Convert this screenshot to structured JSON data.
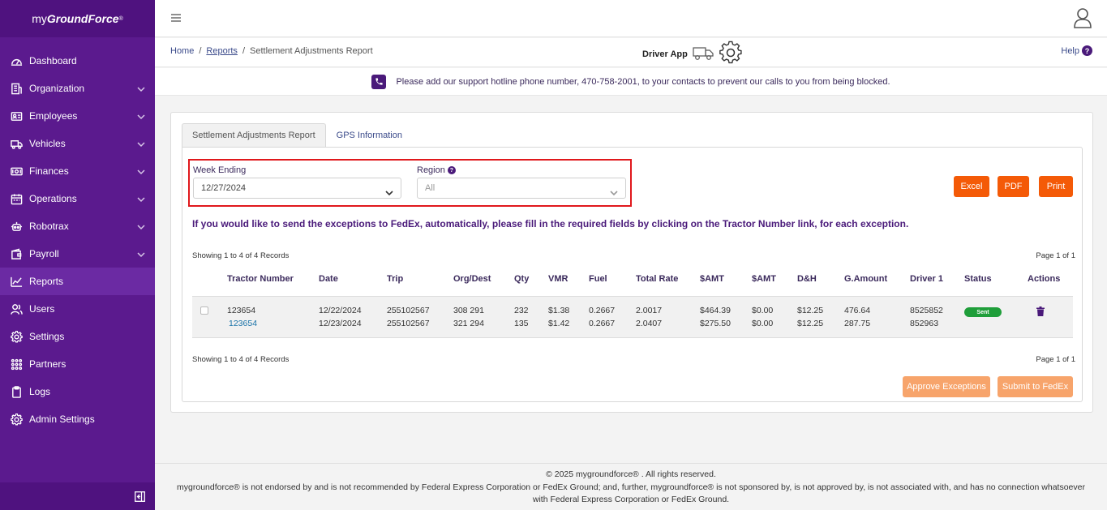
{
  "brand": {
    "prefix": "my",
    "name": "GroundForce",
    "mark": "®"
  },
  "sidebar": {
    "items": [
      {
        "label": "Dashboard",
        "icon": "dashboard-icon",
        "has_chevron": false
      },
      {
        "label": "Organization",
        "icon": "building-icon",
        "has_chevron": true
      },
      {
        "label": "Employees",
        "icon": "id-card-icon",
        "has_chevron": true
      },
      {
        "label": "Vehicles",
        "icon": "truck-icon",
        "has_chevron": true
      },
      {
        "label": "Finances",
        "icon": "money-icon",
        "has_chevron": true
      },
      {
        "label": "Operations",
        "icon": "calendar-icon",
        "has_chevron": true
      },
      {
        "label": "Robotrax",
        "icon": "robot-icon",
        "has_chevron": true
      },
      {
        "label": "Payroll",
        "icon": "wallet-icon",
        "has_chevron": true
      },
      {
        "label": "Reports",
        "icon": "chart-line-icon",
        "has_chevron": false,
        "active": true
      },
      {
        "label": "Users",
        "icon": "users-icon",
        "has_chevron": false
      },
      {
        "label": "Settings",
        "icon": "gear-icon",
        "has_chevron": false
      },
      {
        "label": "Partners",
        "icon": "grid-dots-icon",
        "has_chevron": false
      },
      {
        "label": "Logs",
        "icon": "clipboard-icon",
        "has_chevron": false
      },
      {
        "label": "Admin Settings",
        "icon": "admin-gear-icon",
        "has_chevron": false
      }
    ]
  },
  "breadcrumb": {
    "home": "Home",
    "sep": "/",
    "reports": "Reports",
    "current": "Settlement Adjustments Report"
  },
  "driver_app": {
    "label": "Driver App"
  },
  "help": {
    "label": "Help",
    "icon_text": "?"
  },
  "notice": {
    "text": "Please add our support hotline phone number, 470-758-2001, to your contacts to prevent our calls to you from being blocked."
  },
  "tabs": [
    {
      "label": "Settlement Adjustments Report",
      "active": true
    },
    {
      "label": "GPS Information",
      "active": false
    }
  ],
  "filters": {
    "week_ending": {
      "label": "Week Ending",
      "value": "12/27/2024"
    },
    "region": {
      "label": "Region",
      "value": "All",
      "help": "?"
    }
  },
  "buttons": {
    "excel": "Excel",
    "pdf": "PDF",
    "print": "Print",
    "approve": "Approve Exceptions",
    "submit": "Submit to FedEx"
  },
  "info_text": "If you would like to send the exceptions to FedEx, automatically, please fill in the required fields by clicking on the Tractor Number link, for each exception.",
  "records_text": "Showing 1 to 4 of 4 Records",
  "page_text": "Page 1 of 1",
  "table": {
    "headers": [
      "Tractor Number",
      "Date",
      "Trip",
      "Org/Dest",
      "Qty",
      "VMR",
      "Fuel",
      "Total Rate",
      "$AMT",
      "$AMT",
      "D&H",
      "G.Amount",
      "Driver 1",
      "Status",
      "Actions"
    ],
    "row": {
      "tractor": [
        "123654",
        "123654"
      ],
      "date": [
        "12/22/2024",
        "12/23/2024"
      ],
      "trip": [
        "255102567",
        "255102567"
      ],
      "orgdest": [
        "308 291",
        "321 294"
      ],
      "qty": [
        "232",
        "135"
      ],
      "vmr": [
        "$1.38",
        "$1.42"
      ],
      "fuel": [
        "0.2667",
        "0.2667"
      ],
      "total_rate": [
        "2.0017",
        "2.0407"
      ],
      "amt1": [
        "$464.39",
        "$275.50"
      ],
      "amt2": [
        "$0.00",
        "$0.00"
      ],
      "dh": [
        "$12.25",
        "$12.25"
      ],
      "gamount": [
        "476.64",
        "287.75"
      ],
      "driver1": [
        "8525852",
        "852963"
      ],
      "status": "Sent"
    }
  },
  "footer": {
    "line1": "© 2025 mygroundforce® . All rights reserved.",
    "line2": "mygroundforce® is not endorsed by and is not recommended by Federal Express Corporation or FedEx Ground; and, further, mygroundforce® is not sponsored by, is not approved by, is not associated with, and has no connection whatsoever",
    "line3": "with Federal Express Corporation or FedEx Ground."
  },
  "colors": {
    "sidebar": "#5b1a8e",
    "accent": "#f45a07",
    "accent_disabled": "#f7a46b",
    "status_sent": "#1f9e3a",
    "highlight_border": "#e0181c"
  }
}
